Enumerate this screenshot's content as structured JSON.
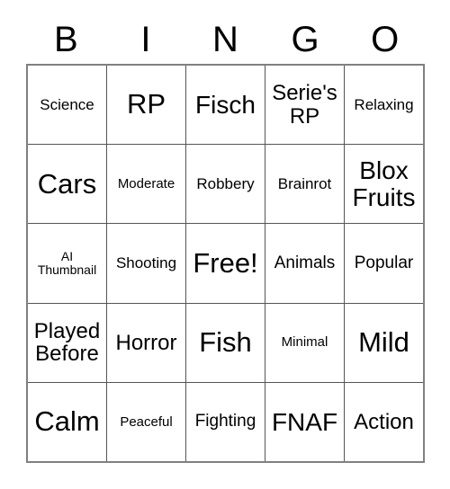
{
  "card": {
    "title": "BINGO",
    "header_letters": [
      "B",
      "I",
      "N",
      "G",
      "O"
    ],
    "rows": [
      [
        {
          "text": "Science",
          "size": "sz-m"
        },
        {
          "text": "RP",
          "size": "sz-xxl"
        },
        {
          "text": "Fisch",
          "size": "sz-xl"
        },
        {
          "text": "Serie's\nRP",
          "size": "sz-l"
        },
        {
          "text": "Relaxing",
          "size": "sz-m"
        }
      ],
      [
        {
          "text": "Cars",
          "size": "sz-xxl"
        },
        {
          "text": "Moderate",
          "size": "sz-s"
        },
        {
          "text": "Robbery",
          "size": "sz-m"
        },
        {
          "text": "Brainrot",
          "size": "sz-m"
        },
        {
          "text": "Blox\nFruits",
          "size": "sz-xl"
        }
      ],
      [
        {
          "text": "AI\nThumbnail",
          "size": "sz-xs"
        },
        {
          "text": "Shooting",
          "size": "sz-m"
        },
        {
          "text": "Free!",
          "size": "sz-xxl"
        },
        {
          "text": "Animals",
          "size": "sz-ml"
        },
        {
          "text": "Popular",
          "size": "sz-ml"
        }
      ],
      [
        {
          "text": "Played\nBefore",
          "size": "sz-l"
        },
        {
          "text": "Horror",
          "size": "sz-l"
        },
        {
          "text": "Fish",
          "size": "sz-xxl"
        },
        {
          "text": "Minimal",
          "size": "sz-s"
        },
        {
          "text": "Mild",
          "size": "sz-xxl"
        }
      ],
      [
        {
          "text": "Calm",
          "size": "sz-xxl"
        },
        {
          "text": "Peaceful",
          "size": "sz-s"
        },
        {
          "text": "Fighting",
          "size": "sz-ml"
        },
        {
          "text": "FNAF",
          "size": "sz-xl"
        },
        {
          "text": "Action",
          "size": "sz-l"
        }
      ]
    ],
    "free_space": {
      "row": 2,
      "column": 2,
      "label": "Free!"
    },
    "colors": {
      "text": "#000000",
      "background": "#ffffff",
      "outer_border": "#808080",
      "inner_border": "#555555"
    }
  }
}
